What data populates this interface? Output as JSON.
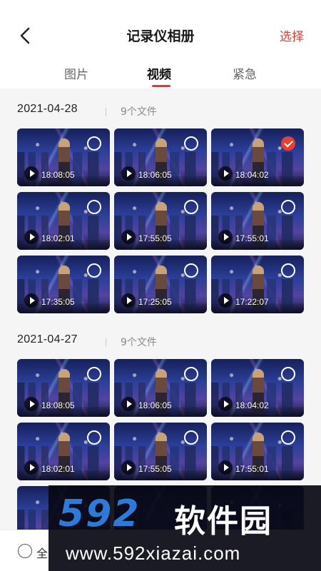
{
  "header": {
    "title": "记录仪相册",
    "select_label": "选择",
    "back_icon": "chevron-left-icon"
  },
  "tabs": [
    {
      "label": "图片",
      "active": false
    },
    {
      "label": "视频",
      "active": true
    },
    {
      "label": "紧急",
      "active": false
    }
  ],
  "colors": {
    "accent": "#e23a2e",
    "background": "#f5f5f5"
  },
  "sections": [
    {
      "date": "2021-04-28",
      "count": "9个文件",
      "videos": [
        {
          "time": "18:08:05",
          "selected": false
        },
        {
          "time": "18:06:05",
          "selected": false
        },
        {
          "time": "18:04:02",
          "selected": true
        },
        {
          "time": "18:02:01",
          "selected": false
        },
        {
          "time": "17:55:05",
          "selected": false
        },
        {
          "time": "17:55:01",
          "selected": false
        },
        {
          "time": "17:35:05",
          "selected": false
        },
        {
          "time": "17:25:05",
          "selected": false
        },
        {
          "time": "17:22:07",
          "selected": false
        }
      ]
    },
    {
      "date": "2021-04-27",
      "count": "9个文件",
      "videos": [
        {
          "time": "18:08:05",
          "selected": false
        },
        {
          "time": "18:06:05",
          "selected": false
        },
        {
          "time": "18:04:02",
          "selected": false
        },
        {
          "time": "18:02:01",
          "selected": false
        },
        {
          "time": "17:55:05",
          "selected": false
        },
        {
          "time": "17:55:01",
          "selected": false
        }
      ]
    }
  ],
  "bottom_bar": {
    "select_all_label": "全"
  },
  "watermark": {
    "brand_num": "592",
    "brand_cn": "软件园",
    "url": "www.592xiazai.com"
  }
}
